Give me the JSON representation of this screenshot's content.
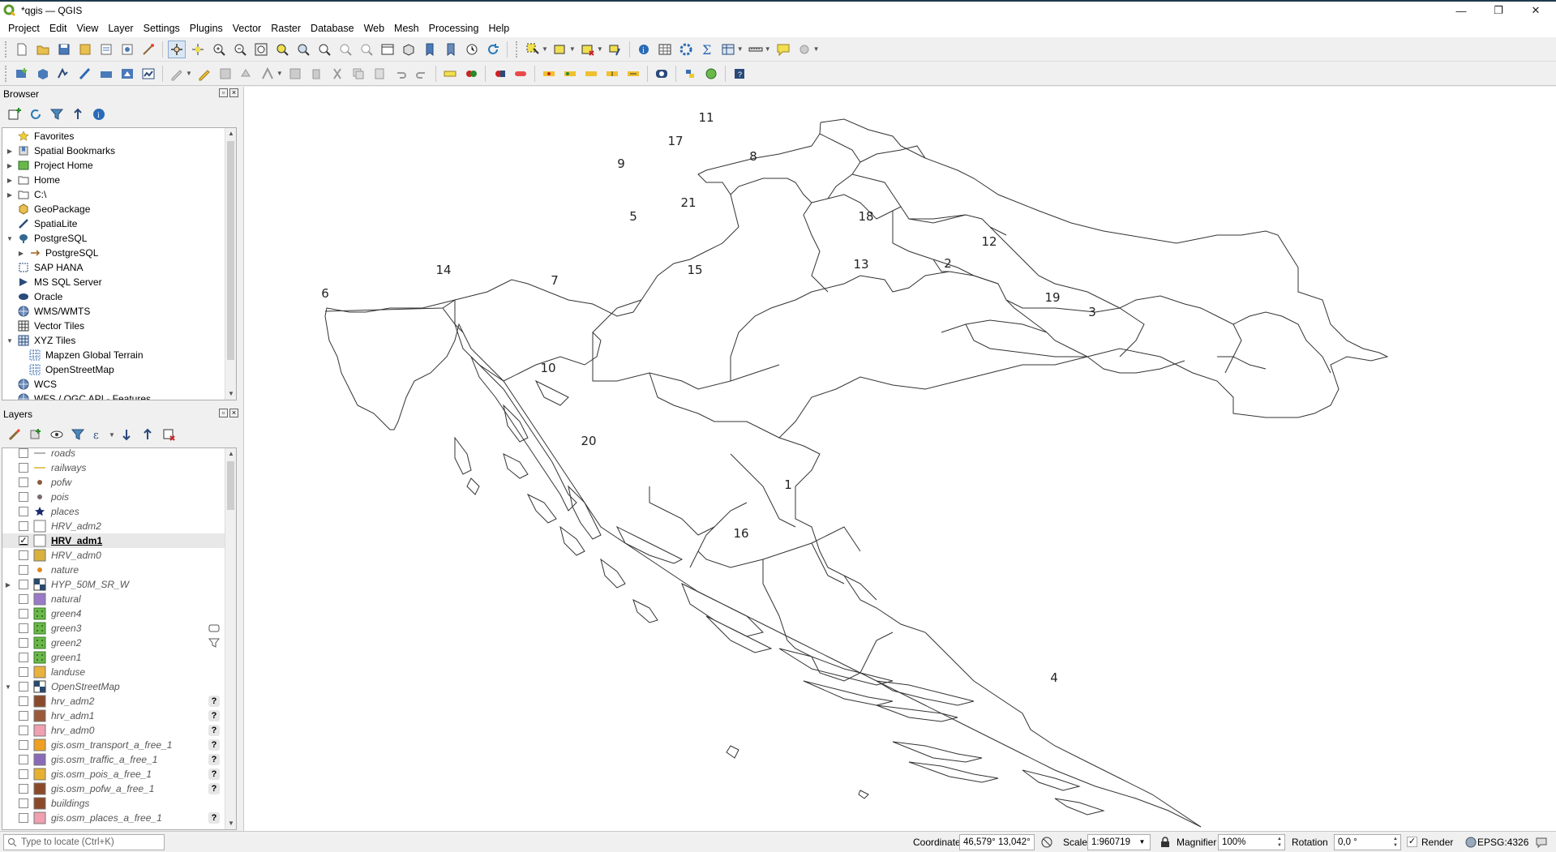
{
  "window": {
    "title": "*qgis — QGIS",
    "minimize": "—",
    "restore": "❐",
    "close": "✕"
  },
  "menu": [
    "Project",
    "Edit",
    "View",
    "Layer",
    "Settings",
    "Plugins",
    "Vector",
    "Raster",
    "Database",
    "Web",
    "Mesh",
    "Processing",
    "Help"
  ],
  "browser": {
    "title": "Browser",
    "items": [
      {
        "label": "Favorites",
        "arrow": "",
        "icon": "star-icon"
      },
      {
        "label": "Spatial Bookmarks",
        "arrow": "▶",
        "icon": "bookmark-icon"
      },
      {
        "label": "Project Home",
        "arrow": "▶",
        "icon": "project-home-icon"
      },
      {
        "label": "Home",
        "arrow": "▶",
        "icon": "folder-icon"
      },
      {
        "label": "C:\\",
        "arrow": "▶",
        "icon": "folder-icon"
      },
      {
        "label": "GeoPackage",
        "arrow": "",
        "icon": "geopackage-icon"
      },
      {
        "label": "SpatiaLite",
        "arrow": "",
        "icon": "spatialite-icon"
      },
      {
        "label": "PostgreSQL",
        "arrow": "▼",
        "icon": "postgresql-icon"
      },
      {
        "label": "PostgreSQL",
        "arrow": "▶",
        "icon": "connection-icon",
        "indent": true
      },
      {
        "label": "SAP HANA",
        "arrow": "",
        "icon": "saphana-icon"
      },
      {
        "label": "MS SQL Server",
        "arrow": "",
        "icon": "mssql-icon"
      },
      {
        "label": "Oracle",
        "arrow": "",
        "icon": "oracle-icon"
      },
      {
        "label": "WMS/WMTS",
        "arrow": "",
        "icon": "globe-icon"
      },
      {
        "label": "Vector Tiles",
        "arrow": "",
        "icon": "vector-tiles-icon"
      },
      {
        "label": "XYZ Tiles",
        "arrow": "▼",
        "icon": "xyz-tiles-icon"
      },
      {
        "label": "Mapzen Global Terrain",
        "arrow": "",
        "icon": "tile-layer-icon",
        "indent": true
      },
      {
        "label": "OpenStreetMap",
        "arrow": "",
        "icon": "tile-layer-icon",
        "indent": true
      },
      {
        "label": "WCS",
        "arrow": "",
        "icon": "globe-icon"
      },
      {
        "label": "WFS / OGC API - Features",
        "arrow": "",
        "icon": "globe-icon"
      }
    ]
  },
  "layers": {
    "title": "Layers",
    "items": [
      {
        "label": "roads",
        "symbol": "line",
        "color": "#9a9a9a",
        "checked": false
      },
      {
        "label": "railways",
        "symbol": "line",
        "color": "#d9b43c",
        "checked": false
      },
      {
        "label": "pofw",
        "symbol": "dot",
        "color": "#8a5a3c",
        "checked": false
      },
      {
        "label": "pois",
        "symbol": "dot",
        "color": "#7a6a6a",
        "checked": false
      },
      {
        "label": "places",
        "symbol": "star",
        "color": "#1a2a6a",
        "checked": false
      },
      {
        "label": "HRV_adm2",
        "symbol": "fill",
        "color": "#ffffff",
        "checked": false
      },
      {
        "label": "HRV_adm1",
        "symbol": "fill",
        "color": "#ffffff",
        "checked": true,
        "active": true
      },
      {
        "label": "HRV_adm0",
        "symbol": "fill",
        "color": "#d8b23c",
        "checked": false
      },
      {
        "label": "nature",
        "symbol": "dot",
        "color": "#e08a1c",
        "checked": false
      },
      {
        "label": "HYP_50M_SR_W",
        "symbol": "raster",
        "color": "#2a4a6a",
        "checked": false,
        "arrow": "▶"
      },
      {
        "label": "natural",
        "symbol": "fill",
        "color": "#9a7ac8",
        "checked": false
      },
      {
        "label": "green4",
        "symbol": "pattern",
        "color": "#6ab84a",
        "checked": false
      },
      {
        "label": "green3",
        "symbol": "pattern",
        "color": "#6ab84a",
        "checked": false,
        "extra": "comment-icon"
      },
      {
        "label": "green2",
        "symbol": "pattern",
        "color": "#6ab84a",
        "checked": false,
        "extra": "filter-icon"
      },
      {
        "label": "green1",
        "symbol": "pattern",
        "color": "#6ab84a",
        "checked": false
      },
      {
        "label": "landuse",
        "symbol": "fill",
        "color": "#e8b23c",
        "checked": false
      },
      {
        "label": "OpenStreetMap",
        "symbol": "raster",
        "color": "#2a4a6a",
        "checked": false,
        "arrow": "▼"
      },
      {
        "label": "hrv_adm2",
        "symbol": "fill",
        "color": "#8a4a2a",
        "checked": false,
        "qmark": "?"
      },
      {
        "label": "hrv_adm1",
        "symbol": "fill",
        "color": "#9a5a3a",
        "checked": false,
        "qmark": "?"
      },
      {
        "label": "hrv_adm0",
        "symbol": "fill",
        "color": "#f0a0b0",
        "checked": false,
        "qmark": "?"
      },
      {
        "label": "gis.osm_transport_a_free_1",
        "symbol": "fill",
        "color": "#f0a020",
        "checked": false,
        "qmark": "?"
      },
      {
        "label": "gis.osm_traffic_a_free_1",
        "symbol": "fill",
        "color": "#8a6ab8",
        "checked": false,
        "qmark": "?"
      },
      {
        "label": "gis.osm_pois_a_free_1",
        "symbol": "fill",
        "color": "#e8b030",
        "checked": false,
        "qmark": "?"
      },
      {
        "label": "gis.osm_pofw_a_free_1",
        "symbol": "fill",
        "color": "#8a4a2a",
        "checked": false,
        "qmark": "?"
      },
      {
        "label": "buildings",
        "symbol": "fill",
        "color": "#8a4a2a",
        "checked": false
      },
      {
        "label": "gis.osm_places_a_free_1",
        "symbol": "fill",
        "color": "#f0a0b0",
        "checked": false,
        "qmark": "?"
      }
    ]
  },
  "map": {
    "labels": [
      "1",
      "2",
      "3",
      "4",
      "5",
      "6",
      "7",
      "8",
      "9",
      "10",
      "11",
      "12",
      "13",
      "14",
      "15",
      "16",
      "17",
      "18",
      "19",
      "20",
      "21"
    ]
  },
  "status": {
    "locate_placeholder": "Type to locate (Ctrl+K)",
    "coordinate_label": "Coordinate",
    "coordinate_value": "46,579° 13,042°",
    "scale_label": "Scale",
    "scale_value": "1:960719",
    "magnifier_label": "Magnifier",
    "magnifier_value": "100%",
    "rotation_label": "Rotation",
    "rotation_value": "0,0 °",
    "render_label": "Render",
    "render_checked": "✓",
    "crs": "EPSG:4326"
  }
}
